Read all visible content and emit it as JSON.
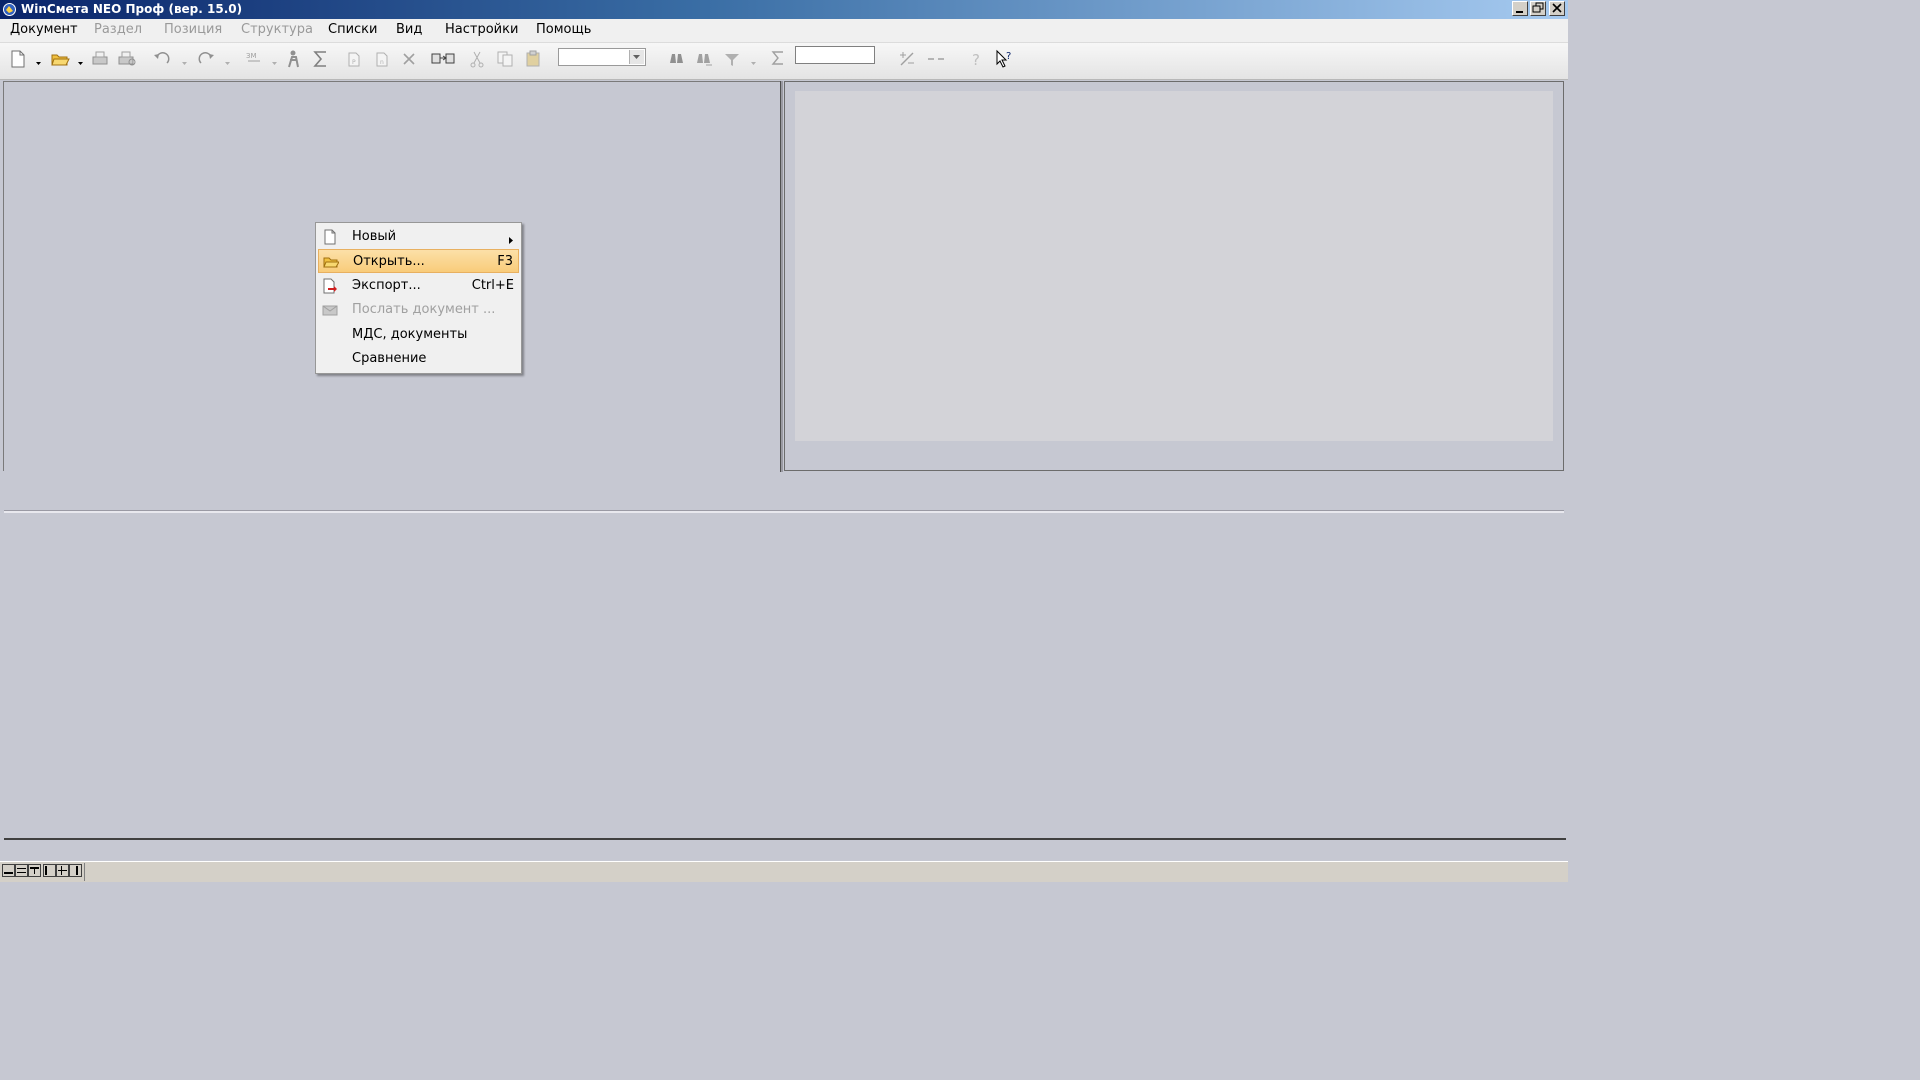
{
  "window": {
    "title": "WinСмета NEO Проф (вер. 15.0)",
    "controls": [
      "minimize-icon",
      "restore-icon",
      "close-icon"
    ]
  },
  "menubar": {
    "items": [
      {
        "label": "Документ",
        "enabled": true
      },
      {
        "label": "Раздел",
        "enabled": false
      },
      {
        "label": "Позиция",
        "enabled": false
      },
      {
        "label": "Структура",
        "enabled": false
      },
      {
        "label": "Списки",
        "enabled": true
      },
      {
        "label": "Вид",
        "enabled": true
      },
      {
        "label": "Настройки",
        "enabled": true
      },
      {
        "label": "Помощь",
        "enabled": true
      }
    ]
  },
  "toolbar": {
    "icons": [
      "new-document-icon",
      "open-folder-icon",
      "print-icon",
      "print-preview-icon",
      "undo-icon",
      "redo-icon",
      "price-icon",
      "worker-icon",
      "sum-icon",
      "copy-page-icon",
      "paste-page-icon",
      "delete-icon",
      "compare-icon",
      "cut-icon",
      "copy-icon",
      "paste-icon",
      "find-icon",
      "find-next-icon",
      "filter-icon",
      "sigma-icon",
      "percent-icon",
      "minus-icon",
      "help-icon",
      "context-help-icon"
    ],
    "combo_value": "",
    "text_value": ""
  },
  "context_menu": {
    "items": [
      {
        "label": "Новый",
        "shortcut": "",
        "icon": "new-document-icon",
        "submenu": true,
        "enabled": true,
        "highlighted": false
      },
      {
        "label": "Открыть...",
        "shortcut": "F3",
        "icon": "open-folder-icon",
        "submenu": false,
        "enabled": true,
        "highlighted": true
      },
      {
        "label": "Экспорт...",
        "shortcut": "Ctrl+E",
        "icon": "export-icon",
        "submenu": false,
        "enabled": true,
        "highlighted": false
      },
      {
        "label": "Послать документ ...",
        "shortcut": "",
        "icon": "mail-icon",
        "submenu": false,
        "enabled": false,
        "highlighted": false
      },
      {
        "label": "МДС, документы",
        "shortcut": "",
        "icon": "",
        "submenu": false,
        "enabled": true,
        "highlighted": false
      },
      {
        "label": "Сравнение",
        "shortcut": "",
        "icon": "",
        "submenu": false,
        "enabled": true,
        "highlighted": false
      }
    ]
  },
  "colors": {
    "titlebar_start": "#0a246a",
    "titlebar_end": "#a6caf0",
    "workspace": "#c6c8d2",
    "highlight": "#f9cc7a"
  }
}
